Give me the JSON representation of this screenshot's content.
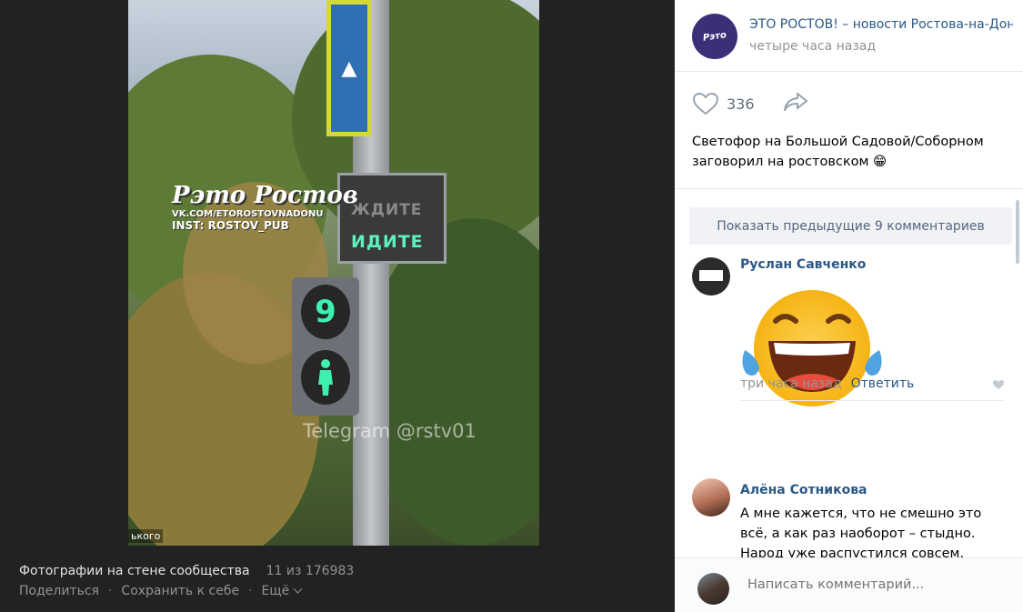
{
  "viewer": {
    "album_title": "Фотографии на стене сообщества",
    "counter": "11 из 176983",
    "share_label": "Поделиться",
    "save_label": "Сохранить к себе",
    "more_label": "Ещё",
    "photo": {
      "watermark_logo": "Рэто Ростов",
      "watermark_vk": "VK.COM/ETOROSTOVNADONU",
      "watermark_inst": "INST: ROSTOV_PUB",
      "sign_top": "ЖДИТЕ",
      "sign_bottom": "ИДИТЕ",
      "countdown": "9",
      "telegram": "Telegram @rstv01",
      "corner_text": "ького"
    }
  },
  "post": {
    "group_name": "ЭТО РОСТОВ! – новости Ростова-на-Дону",
    "time": "четыре часа назад",
    "likes": "336",
    "text": "Светофор на Большой Садовой/Соборном заговорил на ростовском 😁"
  },
  "comments": {
    "show_previous": "Показать предыдущие 9 комментариев",
    "items": [
      {
        "author": "Руслан Савченко",
        "sticker": "laughing-emoji",
        "time": "три часа назад",
        "reply": "Ответить"
      },
      {
        "author": "Алёна Сотникова",
        "text": "А мне кажется, что не смешно это всё, а как раз наоборот – стыдно. Народ уже распустился совсем,"
      }
    ]
  },
  "composer": {
    "placeholder": "Написать комментарий..."
  },
  "colors": {
    "link": "#2a5885",
    "muted": "#939393",
    "viewer_bg": "#222222",
    "button_bg": "#f0f2f5"
  }
}
